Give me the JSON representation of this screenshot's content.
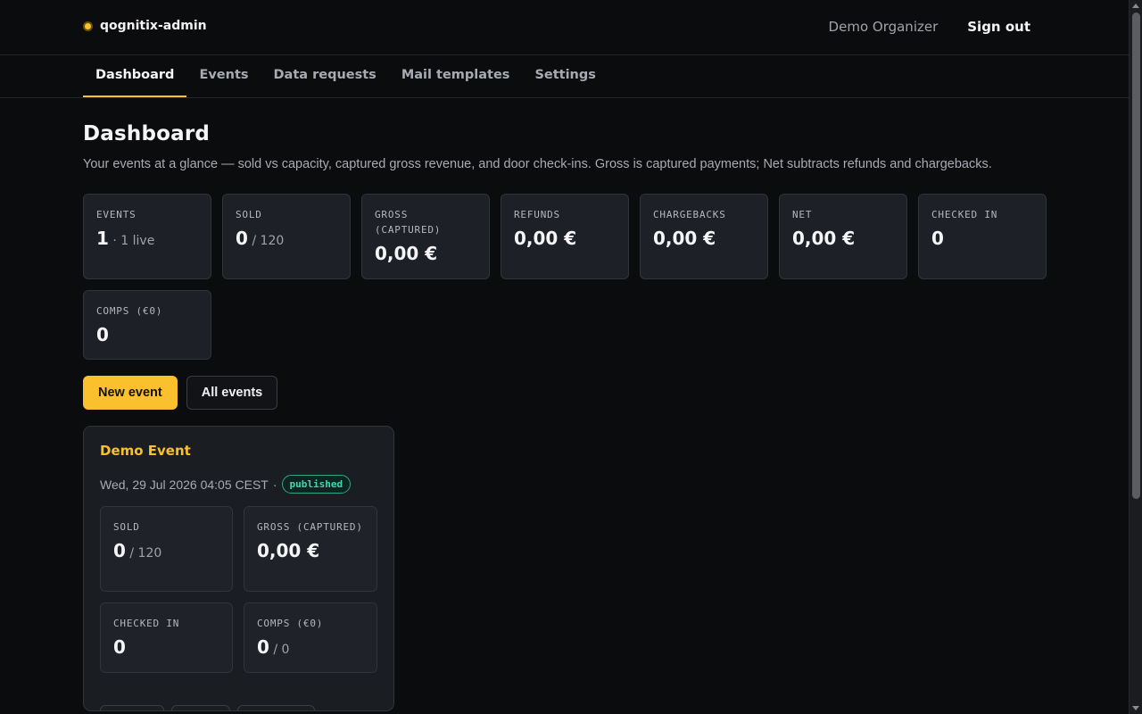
{
  "app": {
    "name": "qognitix-admin",
    "user": "Demo Organizer",
    "signout_label": "Sign out"
  },
  "nav": {
    "tabs": [
      {
        "label": "Dashboard",
        "active": true
      },
      {
        "label": "Events"
      },
      {
        "label": "Data requests"
      },
      {
        "label": "Mail templates"
      },
      {
        "label": "Settings"
      }
    ]
  },
  "page": {
    "title": "Dashboard",
    "description": "Your events at a glance — sold vs capacity, captured gross revenue, and door check-ins. Gross is captured payments; Net subtracts refunds and chargebacks."
  },
  "stats": [
    {
      "label": "EVENTS",
      "value": "1",
      "sub": " · 1 live"
    },
    {
      "label": "SOLD",
      "value": "0",
      "sub": " / 120"
    },
    {
      "label": "GROSS (CAPTURED)",
      "value": "0,00 €",
      "sub": ""
    },
    {
      "label": "REFUNDS",
      "value": "0,00 €",
      "sub": ""
    },
    {
      "label": "CHARGEBACKS",
      "value": "0,00 €",
      "sub": ""
    },
    {
      "label": "NET",
      "value": "0,00 €",
      "sub": ""
    },
    {
      "label": "CHECKED IN",
      "value": "0",
      "sub": ""
    },
    {
      "label": "COMPS (€0)",
      "value": "0",
      "sub": ""
    }
  ],
  "actions": {
    "new_event": "New event",
    "all_events": "All events"
  },
  "event": {
    "title": "Demo Event",
    "date": "Wed, 29 Jul 2026 04:05 CEST",
    "separator": "·",
    "status": "published",
    "stats": [
      {
        "label": "SOLD",
        "value": "0",
        "sub": " / 120"
      },
      {
        "label": "GROSS (CAPTURED)",
        "value": "0,00 €",
        "sub": ""
      },
      {
        "label": "CHECKED IN",
        "value": "0",
        "sub": ""
      },
      {
        "label": "COMPS (€0)",
        "value": "0",
        "sub": " / 0"
      }
    ]
  },
  "colors": {
    "accent": "#fbc02d",
    "status_published": "#43d6b4",
    "background": "#0b0c0e",
    "card": "#1d2026"
  }
}
